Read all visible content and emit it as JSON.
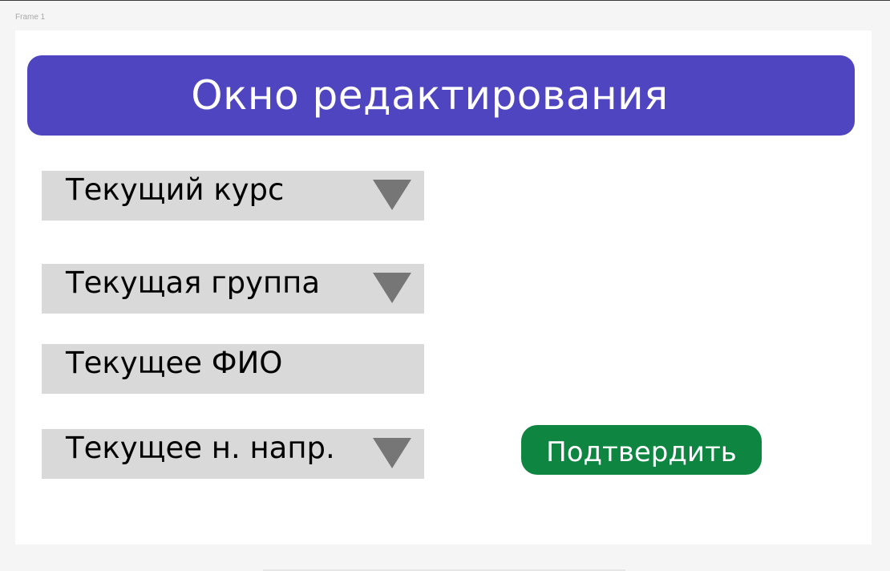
{
  "frame": {
    "label": "Frame 1"
  },
  "header": {
    "title": "Окно редактирования",
    "color": "#4f45c0"
  },
  "form": {
    "course": {
      "label": "Текущий курс",
      "icon": "triangle-down-icon"
    },
    "group": {
      "label": "Текущая группа",
      "icon": "triangle-down-icon"
    },
    "name": {
      "label": "Текущее ФИО"
    },
    "direction": {
      "label": "Текущее н. напр.",
      "icon": "triangle-down-icon"
    },
    "field_color": "#d9d9d9",
    "arrow_color": "#767676"
  },
  "actions": {
    "confirm_label": "Подтвердить",
    "confirm_color": "#0e8541"
  }
}
